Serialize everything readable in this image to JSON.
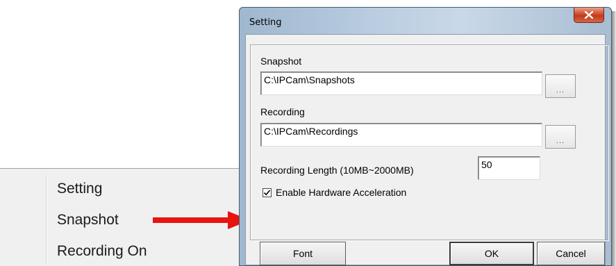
{
  "context_menu": {
    "items": [
      "Setting",
      "Snapshot",
      "Recording On"
    ]
  },
  "dialog": {
    "title": "Setting",
    "close_glyph": "✖",
    "snapshot_label": "Snapshot",
    "snapshot_path": "C:\\IPCam\\Snapshots",
    "recording_label": "Recording",
    "recording_path": "C:\\IPCam\\Recordings",
    "browse_label": "...",
    "length_label": "Recording Length (10MB~2000MB)",
    "length_value": "50",
    "hw_accel_label": "Enable Hardware Acceleration",
    "hw_accel_checked": true,
    "font_button": "Font",
    "ok_button": "OK",
    "cancel_button": "Cancel"
  },
  "colors": {
    "arrow": "#e8140f",
    "close_button": "#c8401f"
  },
  "icons": [
    "close-icon",
    "checkmark-icon",
    "arrow-pointer"
  ]
}
